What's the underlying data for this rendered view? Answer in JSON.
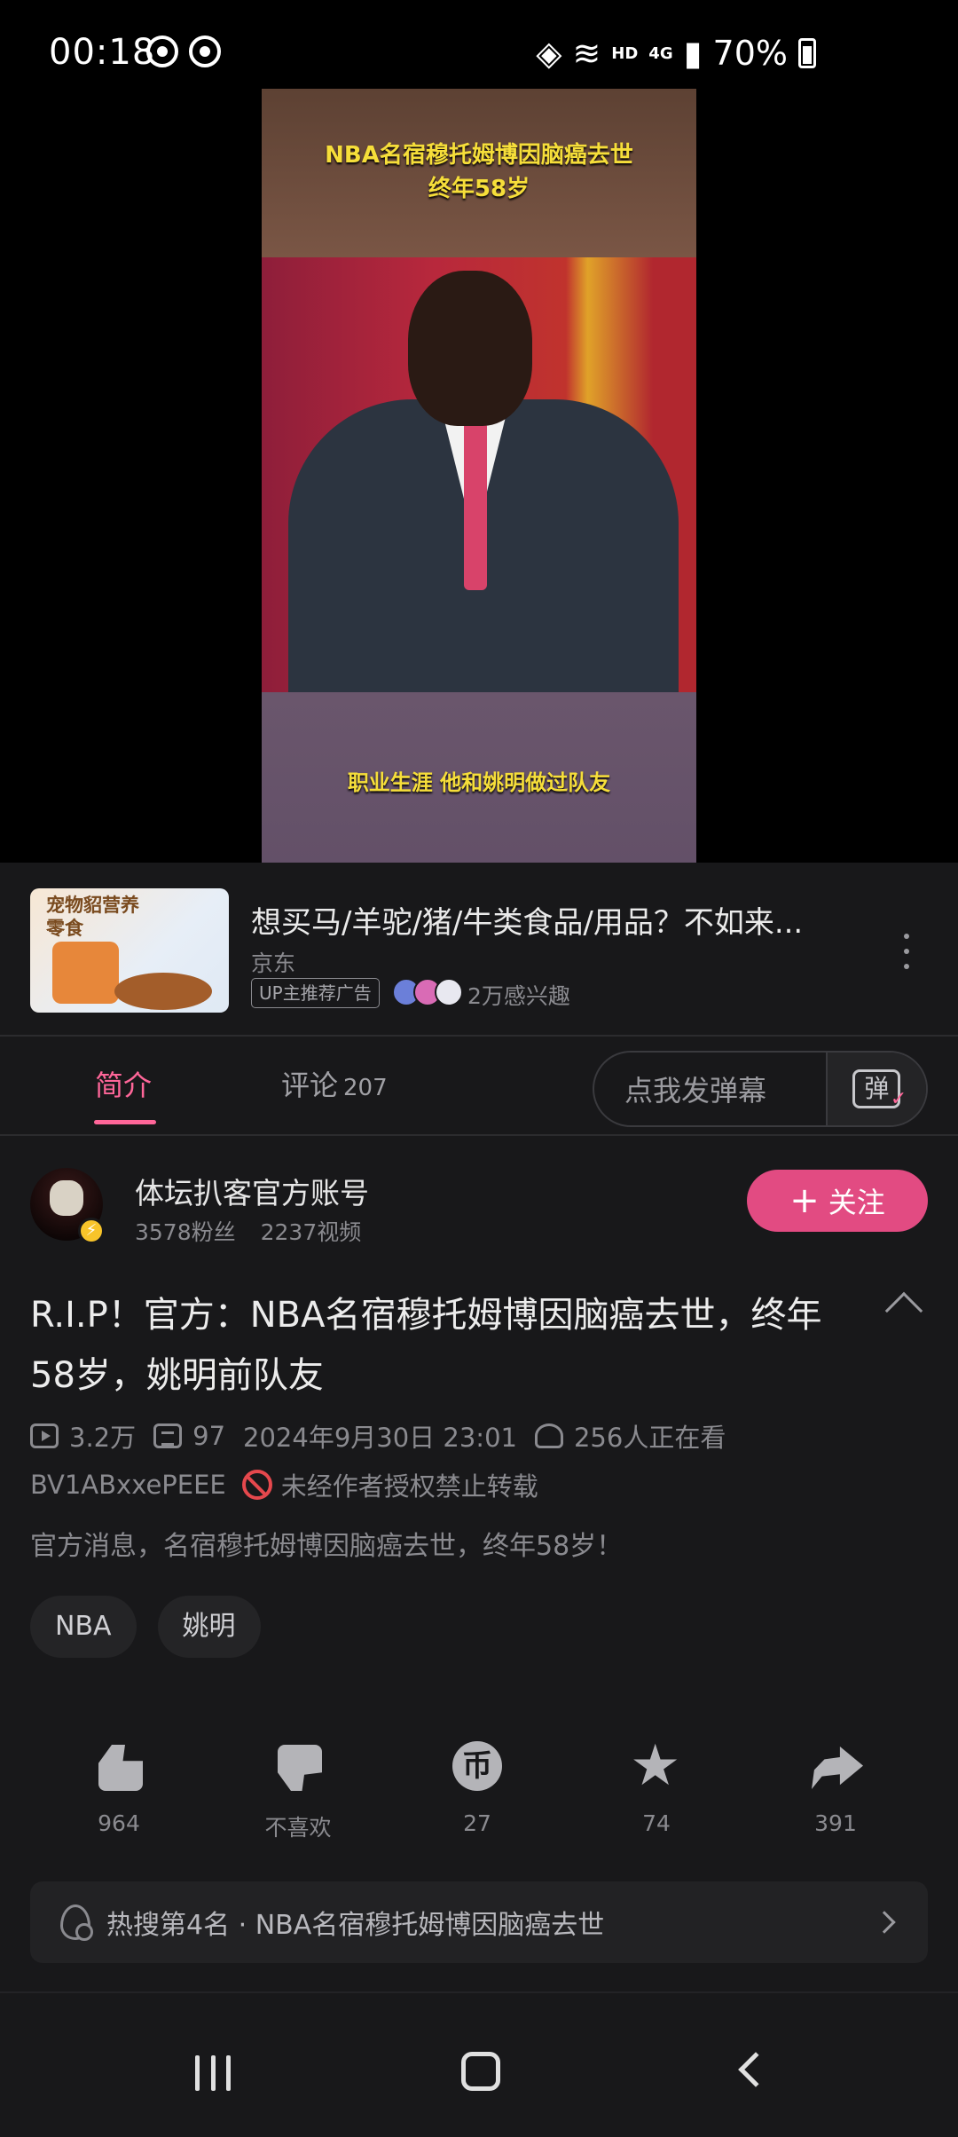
{
  "status_bar": {
    "time": "00:18",
    "network_hd": "HD",
    "network_4g": "4G",
    "battery": "70%"
  },
  "video": {
    "caption_top_line1": "NBA名宿穆托姆博因脑癌去世",
    "caption_top_line2": "终年58岁",
    "caption_bottom": "职业生涯 他和姚明做过队友"
  },
  "ad": {
    "thumb_text": "宠物貂营养零食",
    "title": "想买马/羊驼/猪/牛类食品/用品？不如来...",
    "source": "京东",
    "tag": "UP主推荐广告",
    "interest": "2万感兴趣"
  },
  "tabs": {
    "intro": "简介",
    "comments": "评论",
    "comments_count": "207",
    "danmaku_placeholder": "点我发弹幕",
    "danmaku_button": "弹"
  },
  "uploader": {
    "name": "体坛扒客官方账号",
    "fans": "3578粉丝",
    "videos": "2237视频",
    "follow": "关注"
  },
  "video_info": {
    "title": "R.I.P！官方：NBA名宿穆托姆博因脑癌去世，终年58岁，姚明前队友",
    "views": "3.2万",
    "danmaku_count": "97",
    "date": "2024年9月30日 23:01",
    "watching": "256人正在看",
    "bvid": "BV1ABxxePEEE",
    "copyright": "未经作者授权禁止转载",
    "description": "官方消息，名宿穆托姆博因脑癌去世，终年58岁！",
    "tags": [
      "NBA",
      "姚明"
    ]
  },
  "actions": {
    "like": "964",
    "dislike": "不喜欢",
    "coin": "27",
    "favorite": "74",
    "share": "391",
    "coin_glyph": "币"
  },
  "hot_search": {
    "text": "热搜第4名 · NBA名宿穆托姆博因脑癌去世"
  },
  "colors": {
    "accent": "#ff6699",
    "follow_button": "#e24b82",
    "background": "#18181a"
  }
}
